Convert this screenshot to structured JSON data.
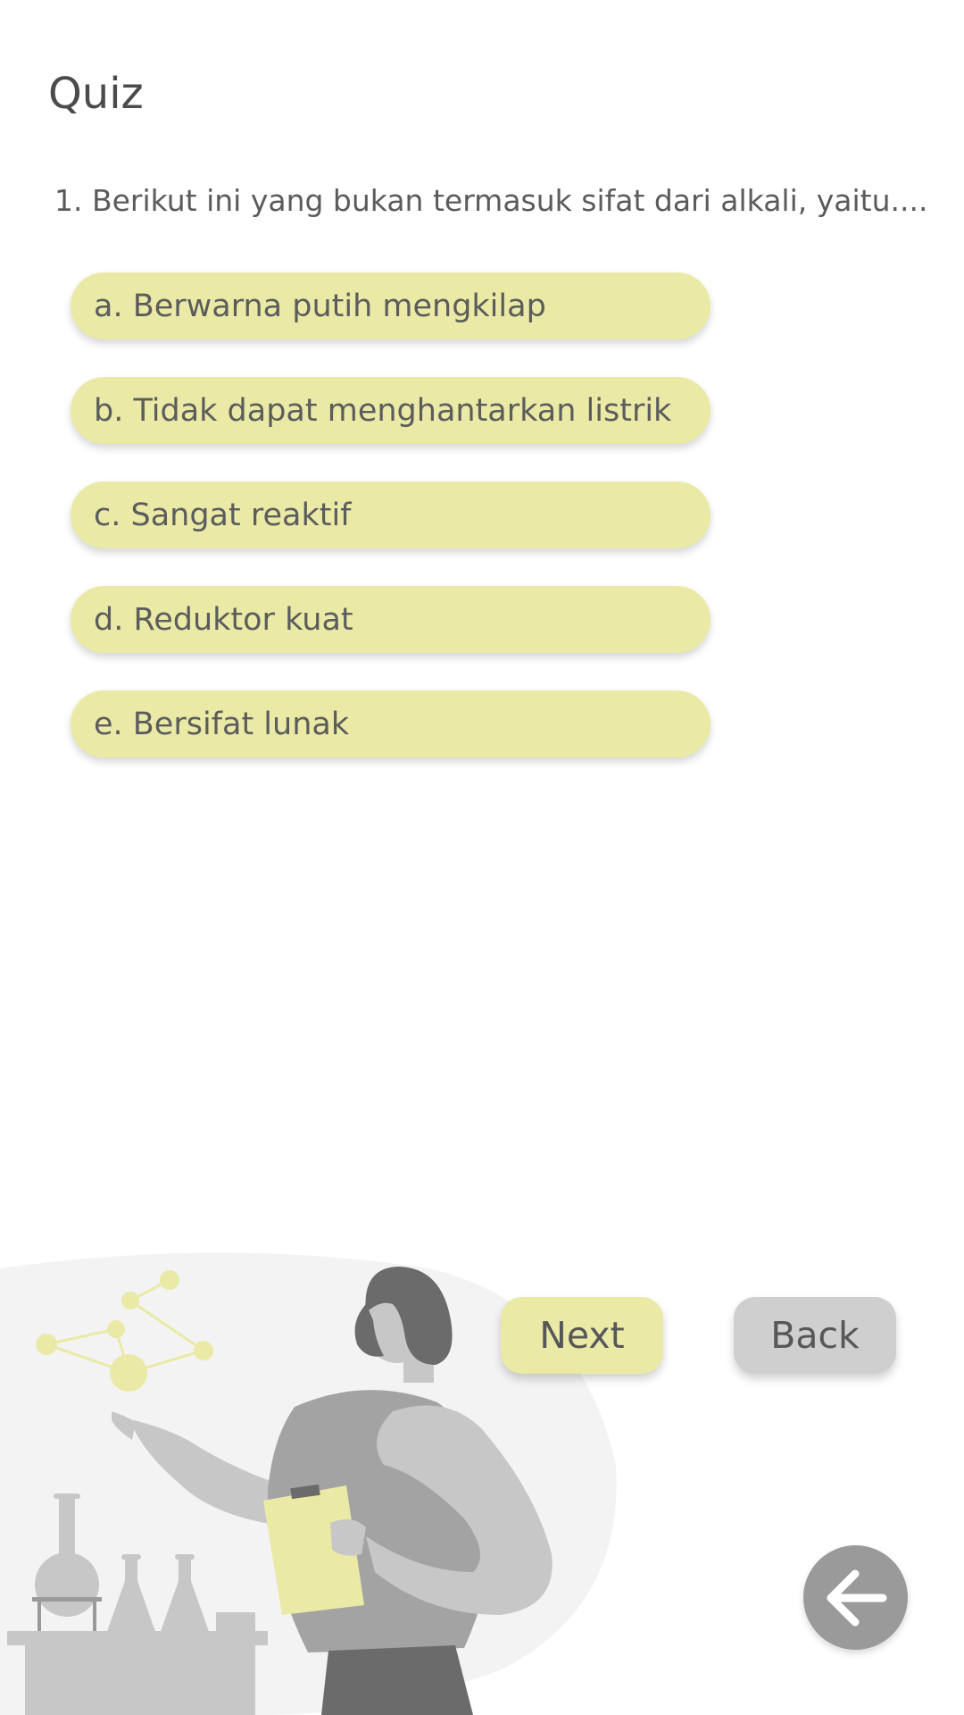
{
  "header": {
    "title": "Quiz"
  },
  "quiz": {
    "question": "1. Berikut ini yang bukan termasuk sifat dari alkali, yaitu....",
    "options": [
      {
        "label": "a. Berwarna putih mengkilap"
      },
      {
        "label": "b. Tidak dapat menghantarkan listrik"
      },
      {
        "label": "c. Sangat reaktif"
      },
      {
        "label": "d. Reduktor kuat"
      },
      {
        "label": "e. Bersifat lunak"
      }
    ]
  },
  "navigation": {
    "next_label": "Next",
    "back_label": "Back"
  },
  "fab": {
    "icon": "arrow-left-icon"
  },
  "colors": {
    "accent": "#eaeaa6",
    "secondary_button": "#cfcfcf",
    "fab": "#9a9a9a",
    "text": "#5c5c5c"
  }
}
